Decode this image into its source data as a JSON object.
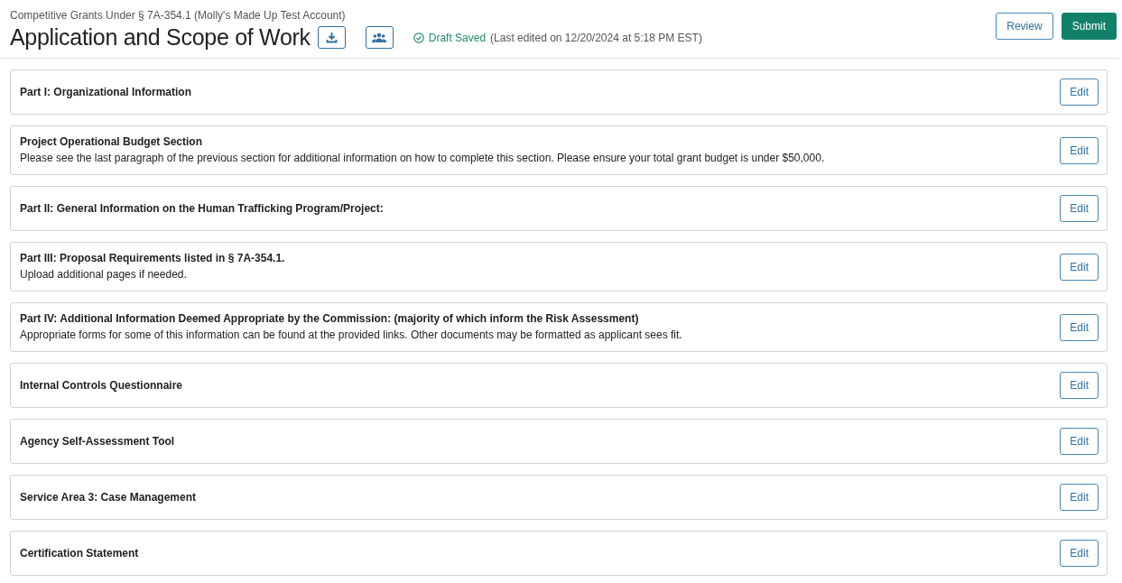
{
  "header": {
    "program": "Competitive Grants Under § 7A-354.1 (Molly's Made Up Test Account)",
    "title": "Application and Scope of Work",
    "status": "Draft Saved",
    "last_edited": "(Last edited on 12/20/2024 at 5:18 PM EST)",
    "buttons": [
      {
        "label": "Review",
        "kind": "outline"
      },
      {
        "label": "Submit",
        "kind": "primary"
      }
    ]
  },
  "sections": [
    {
      "title": "Part I: Organizational Information",
      "action": "Edit"
    },
    {
      "title": "Project Operational Budget Section",
      "description": "Please see the last paragraph of the previous section for additional information on how to complete this section. Please ensure your total grant budget is under $50,000.",
      "action": "Edit"
    },
    {
      "title": "Part II: General Information on the Human Trafficking Program/Project:",
      "action": "Edit"
    },
    {
      "title": "Part III: Proposal Requirements listed in § 7A-354.1.",
      "description": "Upload additional pages if needed.",
      "action": "Edit"
    },
    {
      "title": "Part IV: Additional Information Deemed Appropriate by the Commission: (majority of which inform the Risk Assessment)",
      "description": "Appropriate forms for some of this information can be found at the provided links. Other documents may be formatted as applicant sees fit.",
      "action": "Edit"
    },
    {
      "title": "Internal Controls Questionnaire",
      "action": "Edit"
    },
    {
      "title": "Agency Self-Assessment Tool",
      "action": "Edit"
    },
    {
      "title": "Service Area 3: Case Management",
      "action": "Edit"
    },
    {
      "title": "Certification Statement",
      "action": "Edit"
    }
  ]
}
